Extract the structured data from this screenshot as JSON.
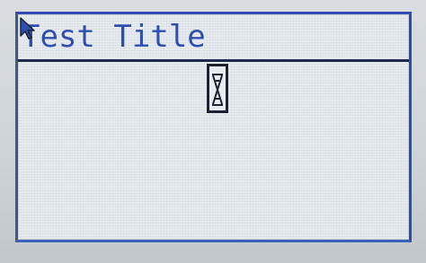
{
  "window": {
    "title": "Test Title"
  },
  "icons": {
    "cursor": "arrow-cursor-icon",
    "loading": "hourglass-icon"
  },
  "colors": {
    "screen_background": "#e6ebf0",
    "title_text": "#2f4fb0",
    "border_dark": "#1f2a4a",
    "border_blue": "#2f4bb0"
  }
}
